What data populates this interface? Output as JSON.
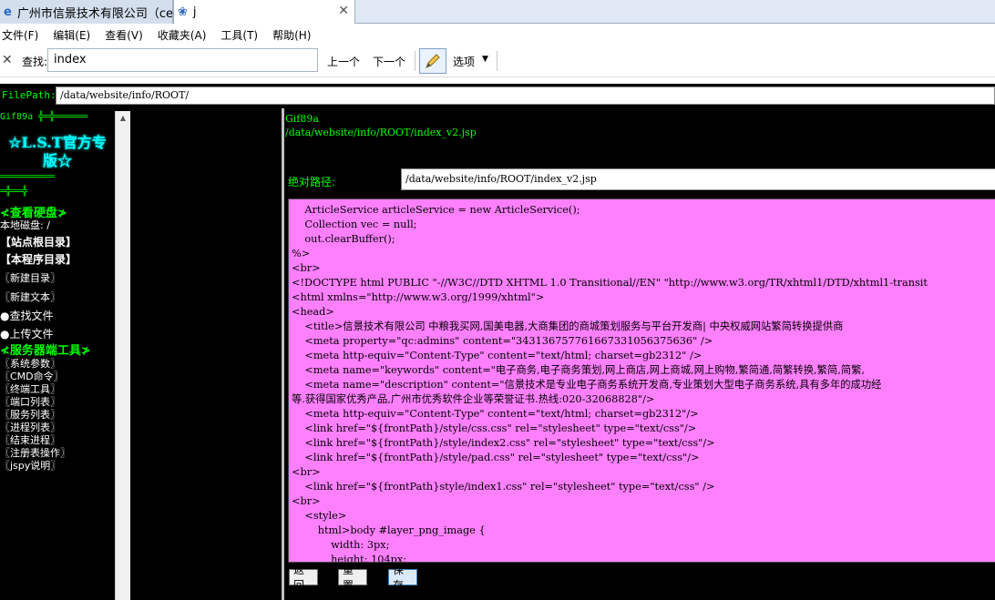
{
  "tabs": [
    {
      "label": "广州市信景技术有限公司（ce..."
    },
    {
      "label": "j"
    }
  ],
  "menu": [
    "文件(F)",
    "编辑(E)",
    "查看(V)",
    "收藏夹(A)",
    "工具(T)",
    "帮助(H)"
  ],
  "findbar": {
    "label": "查找:",
    "value": "index",
    "prev": "上一个",
    "next": "下一个",
    "options": "选项"
  },
  "filepath": {
    "label": "FilePath:",
    "value": "/data/website/info/ROOT/"
  },
  "left": {
    "gif": "Gif89a ╬═╬══════",
    "signature": "☆L.S.T官方专版☆",
    "sep": "══════════",
    "sep2": "═╬══╬",
    "view_disk": "≮查看硬盘≯",
    "local_disk": "本地磁盘: /",
    "site_root": "【站点根目录】",
    "program_dir": "【本程序目录】",
    "new_dir": "〖新建目录〗",
    "new_text": "〖新建文本〗",
    "find_file": "●查找文件",
    "upload_file": "●上传文件",
    "server_tools": "≮服务器端工具≯",
    "tools": [
      "〖系统参数〗",
      "〖CMD命令〗",
      "〖终端工具〗",
      "〖端口列表〗",
      "〖服务列表〗",
      "〖进程列表〗",
      "〖结束进程〗",
      "〖注册表操作〗",
      "〖jspy说明〗"
    ]
  },
  "right": {
    "gif": "Gif89a",
    "path": "/data/website/info/ROOT/index_v2.jsp",
    "abs_label": "绝对路径:",
    "abs_value": "/data/website/info/ROOT/index_v2.jsp",
    "code": "    ArticleService articleService = new ArticleService();\n    Collection vec = null;\n    out.clearBuffer();\n%>\n<br>\n<!DOCTYPE html PUBLIC \"-//W3C//DTD XHTML 1.0 Transitional//EN\" \"http://www.w3.org/TR/xhtml1/DTD/xhtml1-transit\n<html xmlns=\"http://www.w3.org/1999/xhtml\">\n<head>\n    <title>信景技术有限公司 中粮我买网,国美电器,大商集团的商城策划服务与平台开发商| 中央权威网站繁简转换提供商\n    <meta property=\"qc:admins\" content=\"343136757761667331056375636\" />\n    <meta http-equiv=\"Content-Type\" content=\"text/html; charset=gb2312\" />\n    <meta name=\"keywords\" content=\"电子商务,电子商务策划,网上商店,网上商城,网上购物,繁简通,简繁转换,繁简,简繁,\n    <meta name=\"description\" content=\"信景技术是专业电子商务系统开发商,专业策划大型电子商务系统,具有多年的成功经\n等.获得国家优秀产品,广州市优秀软件企业等荣誉证书.热线:020-32068828\"/>\n    <meta http-equiv=\"Content-Type\" content=\"text/html; charset=gb2312\"/>\n    <link href=\"${frontPath}/style/css.css\" rel=\"stylesheet\" type=\"text/css\"/>\n    <link href=\"${frontPath}/style/index2.css\" rel=\"stylesheet\" type=\"text/css\"/>\n    <link href=\"${frontPath}/style/pad.css\" rel=\"stylesheet\" type=\"text/css\"/>\n<br>\n    <link href=\"${frontPath}style/index1.css\" rel=\"stylesheet\" type=\"text/css\" />\n<br>\n    <style>\n        html>body #layer_png_image {\n            width: 3px;\n            height: 104px;",
    "buttons": {
      "back": "返回",
      "reset": "重置",
      "save": "保存"
    }
  }
}
